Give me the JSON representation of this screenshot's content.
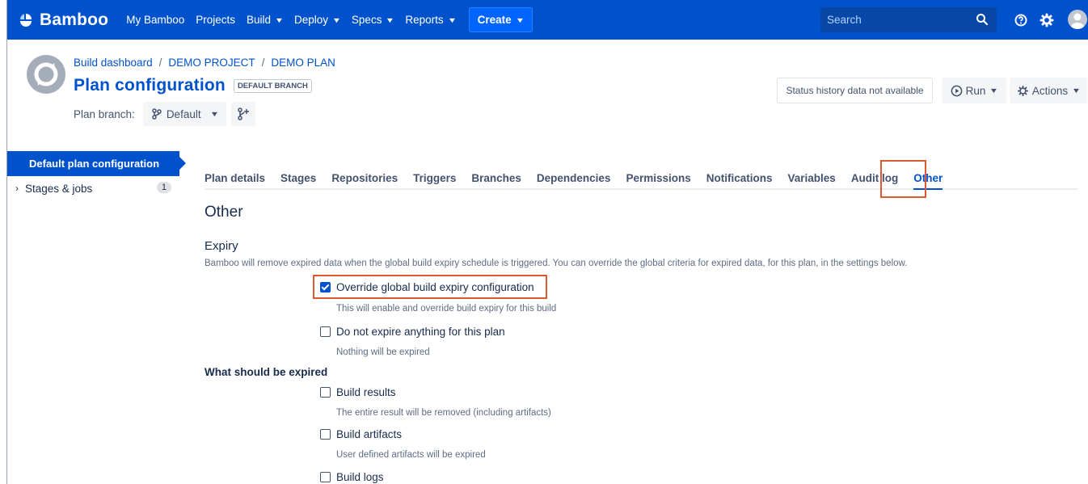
{
  "topnav": {
    "logo": "Bamboo",
    "items": [
      {
        "label": "My Bamboo",
        "dropdown": false
      },
      {
        "label": "Projects",
        "dropdown": false
      },
      {
        "label": "Build",
        "dropdown": true
      },
      {
        "label": "Deploy",
        "dropdown": true
      },
      {
        "label": "Specs",
        "dropdown": true
      },
      {
        "label": "Reports",
        "dropdown": true
      }
    ],
    "create": "Create",
    "search_placeholder": "Search",
    "colors": {
      "bar": "#0052cc",
      "create": "#0065ff"
    }
  },
  "header": {
    "breadcrumb": [
      "Build dashboard",
      "DEMO PROJECT",
      "DEMO PLAN"
    ],
    "title": "Plan configuration",
    "lozenge": "DEFAULT BRANCH",
    "branch_label": "Plan branch:",
    "branch_value": "Default",
    "status": "Status history data not available",
    "run": "Run",
    "actions": "Actions"
  },
  "sidebar": {
    "active": "Default plan configuration",
    "items": [
      {
        "label": "Stages & jobs",
        "count": "1"
      }
    ]
  },
  "tabs": [
    "Plan details",
    "Stages",
    "Repositories",
    "Triggers",
    "Branches",
    "Dependencies",
    "Permissions",
    "Notifications",
    "Variables",
    "Audit log",
    "Other"
  ],
  "active_tab": "Other",
  "content": {
    "heading": "Other",
    "expiry_heading": "Expiry",
    "expiry_desc": "Bamboo will remove expired data when the global build expiry schedule is triggered. You can override the global criteria for expired data, for this plan, in the settings below.",
    "override": {
      "label": "Override global build expiry configuration",
      "hint": "This will enable and override build expiry for this build",
      "checked": true
    },
    "no_expire": {
      "label": "Do not expire anything for this plan",
      "hint": "Nothing will be expired",
      "checked": false
    },
    "what_label": "What should be expired",
    "build_results": {
      "label": "Build results",
      "hint": "The entire result will be removed (including artifacts)",
      "checked": false
    },
    "build_artifacts": {
      "label": "Build artifacts",
      "hint": "User defined artifacts will be expired",
      "checked": false
    },
    "build_logs": {
      "label": "Build logs",
      "checked": false
    }
  },
  "highlight_color": "#dc5a32"
}
